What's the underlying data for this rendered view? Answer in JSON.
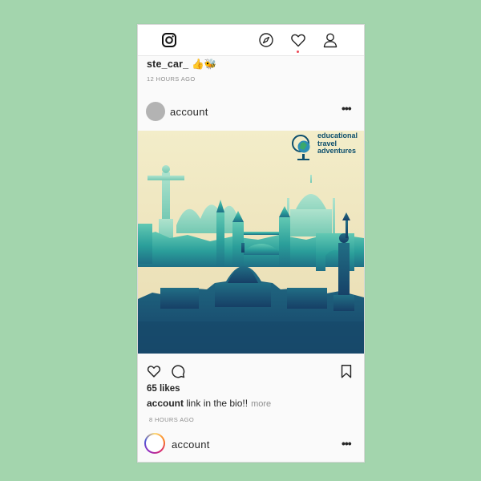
{
  "nav": {
    "icons": [
      "instagram-logo-icon",
      "compass-icon",
      "heart-icon",
      "profile-icon"
    ],
    "notification_color": "#ed4956"
  },
  "previous_post": {
    "username": "ste_car_ 👍🐝",
    "time": "12 HOURS AGO"
  },
  "post": {
    "username": "account",
    "menu": "•••",
    "image_brand": {
      "line1": "educational",
      "line2": "travel",
      "line3": "adventures"
    },
    "likes": "65 likes",
    "caption_user": "account",
    "caption_text": " link in the bio!!",
    "more": "more",
    "time": "8 HOURS AGO"
  },
  "next_post": {
    "username": "account",
    "menu": "•••"
  },
  "colors": {
    "background": "#a3d5ad",
    "card": "#fafafa",
    "text": "#262626",
    "muted": "#8e8e8e",
    "brand_teal": "#0d4f6d"
  }
}
